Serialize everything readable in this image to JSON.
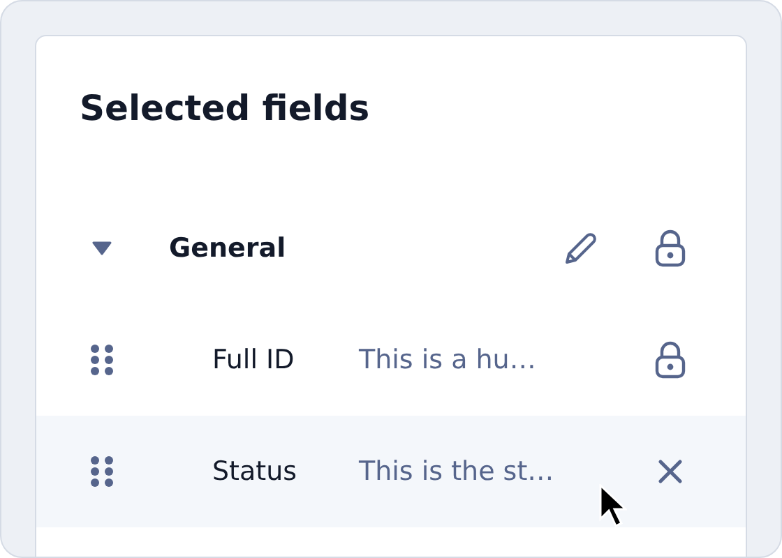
{
  "panel": {
    "title": "Selected fields",
    "groups": [
      {
        "label": "General",
        "expanded": true,
        "actions": [
          {
            "kind": "edit"
          },
          {
            "kind": "lock"
          }
        ],
        "fields": [
          {
            "name": "Full ID",
            "description": "This is a hu…",
            "action": {
              "kind": "lock"
            },
            "hovered": false
          },
          {
            "name": "Status",
            "description": "This is the st…",
            "action": {
              "kind": "remove"
            },
            "hovered": true
          }
        ]
      }
    ]
  }
}
